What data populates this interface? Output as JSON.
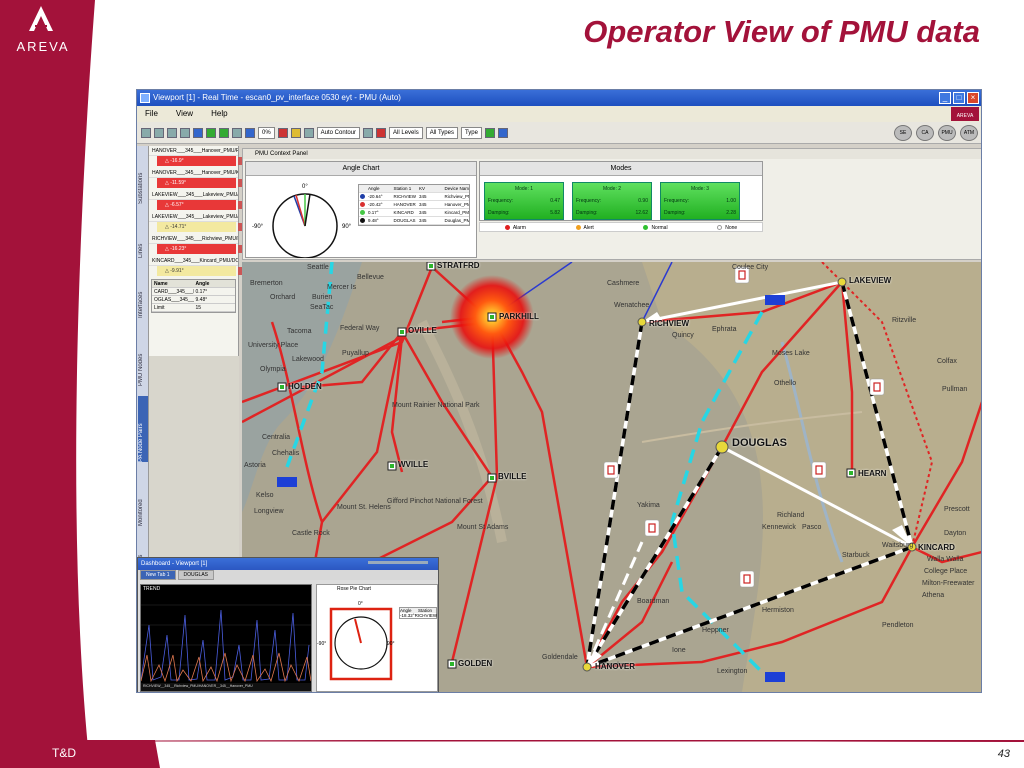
{
  "slide": {
    "title": "Operator View of PMU data",
    "brand": "AREVA",
    "footer": "T&D",
    "page_number": "43"
  },
  "window": {
    "title": "Viewport [1] - Real Time - escan0_pv_interface 0530 eyt - PMU (Auto)",
    "menu": [
      "File",
      "View",
      "Help"
    ],
    "toolbar": {
      "zoom": "0%",
      "contour": "Auto Contour",
      "levels": "All Levels",
      "types": "All Types",
      "type": "Type"
    },
    "right_buttons": [
      "SE",
      "CA",
      "PMU",
      "ATM"
    ]
  },
  "left_tabs": [
    "Substations",
    "Lines",
    "Interfaces",
    "PMU Nodes",
    "PA Node Pairs",
    "Monitored",
    "Mes"
  ],
  "left_panel": {
    "rows": [
      {
        "name": "HANOVER___345___Hanover_PMU/RICH",
        "value": "-16.9°",
        "alarm": true
      },
      {
        "name": "HANOVER___345___Hanover_PMU/KINC",
        "value": "-11.59°",
        "alarm": true
      },
      {
        "name": "LAKEVIEW___345___Lakeview_PMU/KI",
        "value": "-6.57°",
        "alarm": true
      },
      {
        "name": "LAKEVIEW___345___Lakeview_PMU/KI",
        "value": "-14.71°",
        "alarm": false
      },
      {
        "name": "RICHVIEW___345___Richview_PMU/HA",
        "value": "-16.23°",
        "alarm": true
      },
      {
        "name": "KINCARD___345___Kincard_PMU/DOUG",
        "value": "-9.91°",
        "alarm": false
      }
    ],
    "table_header": [
      "Name",
      "Angle"
    ],
    "table_rows": [
      [
        "CARD___345___Kincard_P",
        "0.17°"
      ],
      [
        "OGLAS___345___Douglas_P",
        "9.48°"
      ],
      [
        "Limit",
        "15"
      ]
    ]
  },
  "context_panel": {
    "label": "PMU Context Panel",
    "angle_chart": {
      "title": "Angle Chart",
      "dial_top": "0°",
      "dial_left": "-90°",
      "dial_right": "90°",
      "table_header": [
        "Angle",
        "Station 1",
        "KV",
        "Device Name"
      ],
      "rows": [
        {
          "color": "#1f3ea8",
          "angle": "-20.64°",
          "station": "RICHVIEW",
          "kv": "345",
          "device": "Richview_PMU"
        },
        {
          "color": "#d93030",
          "angle": "-20.42°",
          "station": "HANOVER",
          "kv": "345",
          "device": "Hanover_PMU"
        },
        {
          "color": "#46c846",
          "angle": "0.17°",
          "station": "KINCARD",
          "kv": "345",
          "device": "Kincard_PMU"
        },
        {
          "color": "#111111",
          "angle": "9.48°",
          "station": "DOUGLAS",
          "kv": "345",
          "device": "Douglas_PMU"
        }
      ]
    },
    "modes": {
      "title": "Modes",
      "cards": [
        {
          "mode": "Mode: 1",
          "frequency": "0.47",
          "damping": "5.82"
        },
        {
          "mode": "Mode: 2",
          "frequency": "0.90",
          "damping": "12.62"
        },
        {
          "mode": "Mode: 3",
          "frequency": "1.00",
          "damping": "2.28"
        }
      ],
      "frequency_label": "Frequency:",
      "damping_label": "Damping:",
      "legend": [
        {
          "label": "Alarm",
          "color": "#e02020"
        },
        {
          "label": "Alert",
          "color": "#f0a020"
        },
        {
          "label": "Normal",
          "color": "#30c030"
        },
        {
          "label": "None",
          "color": "#ffffff"
        }
      ]
    }
  },
  "map": {
    "substations": [
      {
        "name": "STRATFRD"
      },
      {
        "name": "PARKHILL"
      },
      {
        "name": "LAKEVIEW"
      },
      {
        "name": "RICHVIEW"
      },
      {
        "name": "DOUGLAS"
      },
      {
        "name": "HEARN"
      },
      {
        "name": "KINCARD"
      },
      {
        "name": "HANOVER"
      },
      {
        "name": "GOLDEN"
      },
      {
        "name": "HOLDEN"
      },
      {
        "name": "WVILLE"
      },
      {
        "name": "BVILLE"
      },
      {
        "name": "OVILLE"
      }
    ],
    "places": [
      "Seattle",
      "Bellevue",
      "Bremerton",
      "Mercer Is",
      "Burien",
      "SeaTac",
      "Federal Way",
      "Tacoma",
      "Puyallup",
      "Olympia",
      "Orchard",
      "University Place",
      "Lakewood",
      "Centralia",
      "Chehalis",
      "Castle Rock",
      "Mount St. Helens",
      "Gifford Pinchot National Forest",
      "Mount Rainier National Park",
      "Mount St Adams",
      "Wenatchee",
      "Cashmere",
      "Quincy",
      "Ephrata",
      "Moses Lake",
      "Othello",
      "Yakima",
      "Richland",
      "Kennewick",
      "Pasco",
      "College Place",
      "Walla Walla",
      "Milton-Freewater",
      "Dayton",
      "Ritzville",
      "Colfax",
      "Pullman",
      "Coulee City",
      "Longview",
      "Kelso",
      "Astoria",
      "Goldendale",
      "Hermiston",
      "Pendleton",
      "Lexington",
      "Condon",
      "Ione",
      "Boardman",
      "Heppner",
      "Athena",
      "Waitsburg",
      "Starbuck",
      "Prescott"
    ]
  },
  "dashboard": {
    "title": "Dashboard - Viewport [1]",
    "tabs": [
      "New Tab 1",
      "DOUGLAS"
    ],
    "trend_label": "TREND",
    "dial_title": "Rose Pie Chart",
    "dial_top": "0°",
    "dial_left": "-90°",
    "dial_right": "90°",
    "angle_header": "Angle",
    "station_header": "Station",
    "angle_value": "-18.32°",
    "station_value": "RICHVIEW",
    "footer_text": "RICHVIEW__345__Richview_PMU/HANOVER__345__Hanover_PMU"
  }
}
